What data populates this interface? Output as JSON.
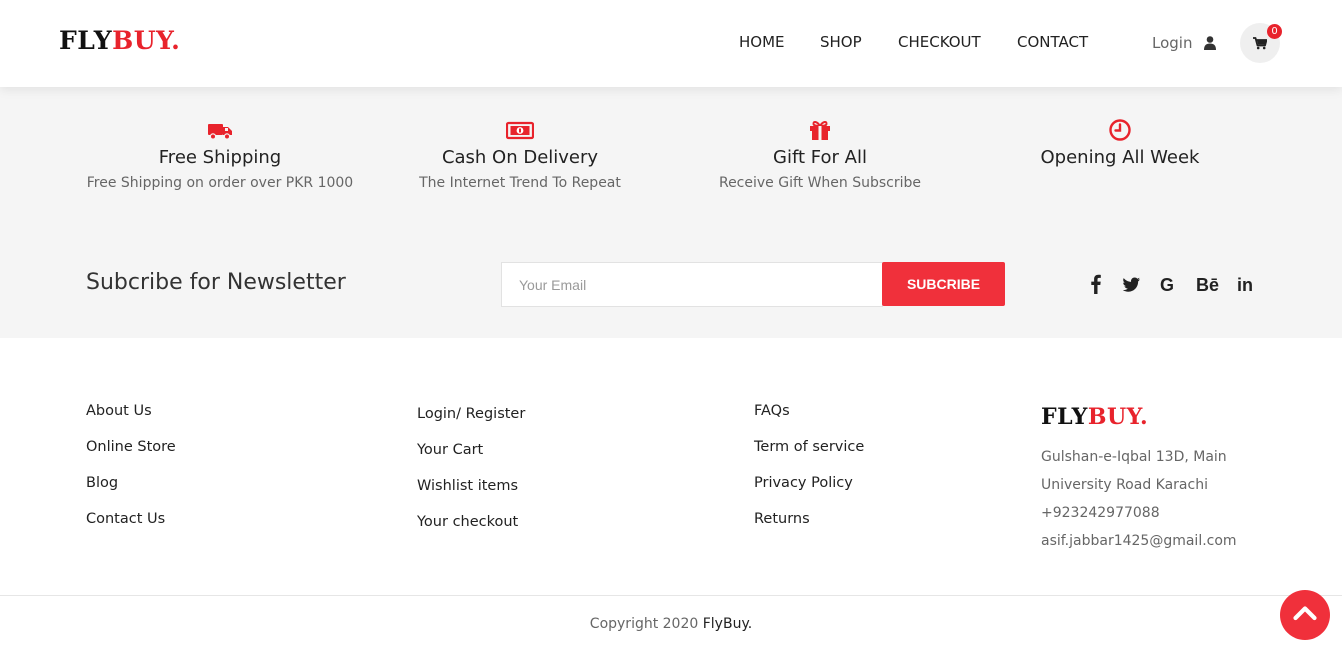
{
  "brand": {
    "name_dark": "FLY",
    "name_accent": "BUY."
  },
  "nav": [
    {
      "label": "HOME"
    },
    {
      "label": "SHOP"
    },
    {
      "label": "CHECKOUT"
    },
    {
      "label": "CONTACT"
    }
  ],
  "header": {
    "login_label": "Login",
    "cart_count": "0",
    "user_icon": "user-icon",
    "cart_icon": "shopping-cart-icon"
  },
  "features": [
    {
      "icon": "truck-icon",
      "title": "Free Shipping",
      "desc": "Free Shipping on order over PKR 1000"
    },
    {
      "icon": "money-icon",
      "title": "Cash On Delivery",
      "desc": "The Internet Trend To Repeat"
    },
    {
      "icon": "gift-icon",
      "title": "Gift For All",
      "desc": "Receive Gift When Subscribe"
    },
    {
      "icon": "clock-icon",
      "title": "Opening All Week",
      "desc": ""
    }
  ],
  "newsletter": {
    "title": "Subcribe for Newsletter",
    "placeholder": "Your Email",
    "button_label": "SUBCRIBE"
  },
  "social": [
    {
      "icon": "facebook-icon",
      "text": "f"
    },
    {
      "icon": "twitter-icon",
      "text": ""
    },
    {
      "icon": "google-icon",
      "text": "G"
    },
    {
      "icon": "behance-icon",
      "text": "Bē"
    },
    {
      "icon": "linkedin-icon",
      "text": "in"
    }
  ],
  "footer": {
    "col1": [
      "About Us",
      "Online Store",
      "Blog",
      "Contact Us"
    ],
    "col2": [
      "Login/ Register",
      "Your Cart",
      "Wishlist items",
      "Your checkout"
    ],
    "col3": [
      "FAQs",
      "Term of service",
      "Privacy Policy",
      "Returns"
    ],
    "contact": {
      "address_line1": "Gulshan-e-Iqbal 13D, Main",
      "address_line2": "University Road Karachi",
      "phone": "+923242977088",
      "email": "asif.jabbar1425@gmail.com"
    },
    "copyright_prefix": "Copyright 2020 ",
    "copyright_brand": "FlyBuy."
  },
  "colors": {
    "accent": "#f0303b",
    "band_bg": "#f5f5f5",
    "text_dark": "#222222",
    "text_muted": "#666666"
  }
}
